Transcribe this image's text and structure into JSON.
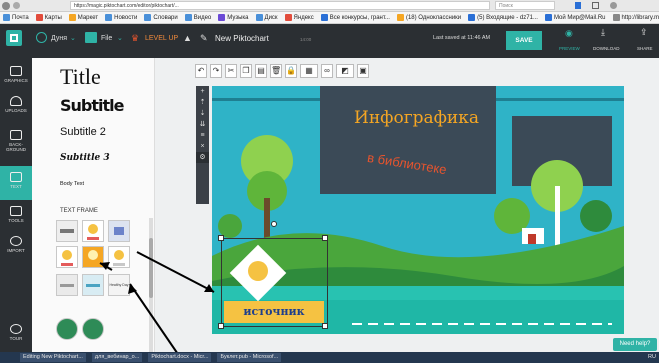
{
  "browser": {
    "url": "https://magic.piktochart.com/editor/piktochart/...",
    "search_placeholder": "Поиск",
    "bookmarks": [
      "Почта",
      "Карты",
      "Маркет",
      "Новости",
      "Словари",
      "Видео",
      "Музыка",
      "Диск",
      "Яндекс",
      "Все конкурсы, грант...",
      "(18) Одноклассники",
      "(5) Входящие - dz71...",
      "Мой Мир@Mail.Ru",
      "http://library.mephi.r..."
    ]
  },
  "app": {
    "user_label": "Дуня",
    "file_label": "File",
    "level_up": "LEVEL UP",
    "doc_title": "New Piktochart",
    "doc_size": "14:00",
    "last_saved": "Last saved at 11:46 AM",
    "save_label": "SAVE",
    "preview_label": "PREVIEW",
    "download_label": "DOWNLOAD",
    "share_label": "SHARE",
    "colors": {
      "accent": "#2fb3a6",
      "dark": "#2b2f33",
      "brand_orange": "#f5a623"
    }
  },
  "sidebar": {
    "items": [
      {
        "label": "GRAPHICS",
        "icon": "image-icon"
      },
      {
        "label": "UPLOADS",
        "icon": "cloud-upload-icon"
      },
      {
        "label": "BACK-",
        "label2": "GROUND",
        "icon": "background-icon"
      },
      {
        "label": "TEXT",
        "icon": "text-icon",
        "active": true
      },
      {
        "label": "TOOLS",
        "icon": "tools-icon"
      },
      {
        "label": "IMPORT",
        "icon": "import-icon"
      },
      {
        "label": "TOUR",
        "icon": "tour-icon"
      }
    ]
  },
  "text_panel": {
    "title": "Title",
    "subtitle": "Subtitle",
    "subtitle2": "Subtitle 2",
    "subtitle3": "Subtitle 3",
    "body": "Body Text",
    "text_frame": "TEXT FRAME",
    "frame_thumb_text": "Healthy Day"
  },
  "canvas": {
    "headline": "Инфографика",
    "subheadline": "в библиотеке",
    "label": "источник"
  },
  "help": {
    "label": "Need help?"
  },
  "taskbar": {
    "items": [
      "Editing New Piktochart...",
      "для_вебинар_о...",
      "Piktochart.docx - Micr...",
      "Буклет.pub - Microsof..."
    ],
    "lang": "RU"
  }
}
